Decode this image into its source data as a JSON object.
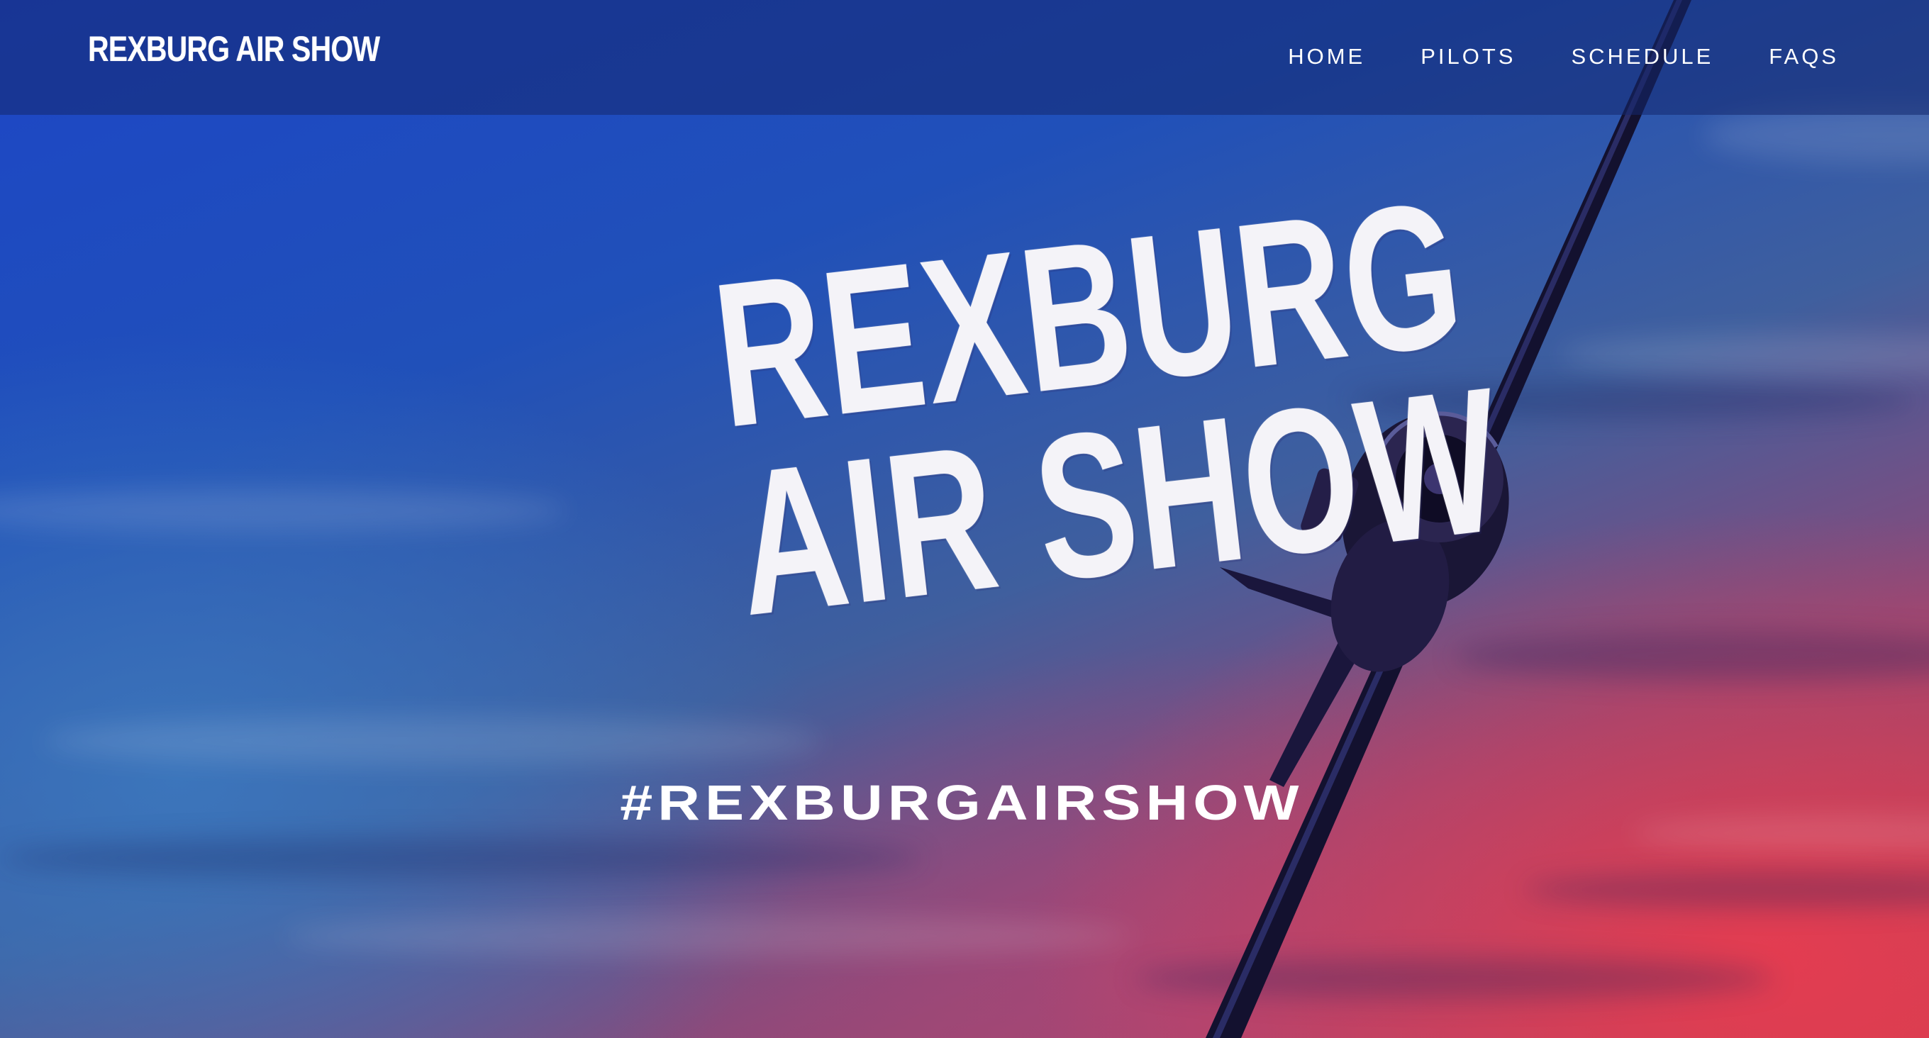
{
  "header": {
    "brand": "REXBURG AIR SHOW",
    "nav": [
      {
        "label": "HOME"
      },
      {
        "label": "PILOTS"
      },
      {
        "label": "SCHEDULE"
      },
      {
        "label": "FAQS"
      }
    ]
  },
  "hero": {
    "logo_line1": "REXBURG",
    "logo_line2": "AIR SHOW",
    "hashtag": "#REXBURGAIRSHOW"
  },
  "colors": {
    "sky_blue": "#1d46c6",
    "sky_red": "#c7404f",
    "text": "#ffffff"
  }
}
